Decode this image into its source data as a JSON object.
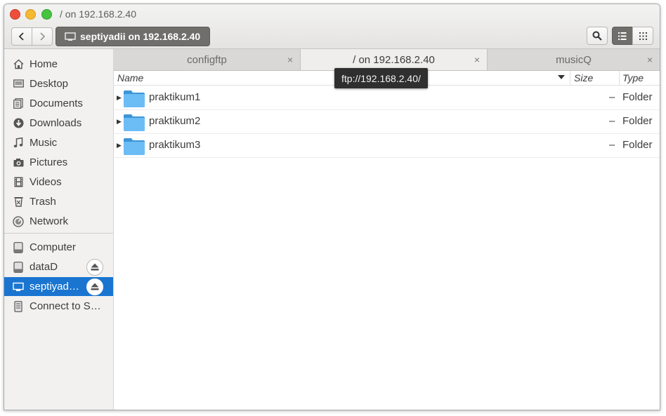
{
  "window": {
    "title": "/ on 192.168.2.40"
  },
  "toolbar": {
    "back_icon": "chevron-left-icon",
    "forward_icon": "chevron-right-icon",
    "location_label": "septiyadii on 192.168.2.40",
    "search_icon": "search-icon",
    "list_view_icon": "list-view-icon",
    "grid_view_icon": "grid-view-icon"
  },
  "sidebar": {
    "places": [
      {
        "label": "Home",
        "icon": "home-icon"
      },
      {
        "label": "Desktop",
        "icon": "desktop-icon"
      },
      {
        "label": "Documents",
        "icon": "documents-icon"
      },
      {
        "label": "Downloads",
        "icon": "downloads-icon"
      },
      {
        "label": "Music",
        "icon": "music-icon"
      },
      {
        "label": "Pictures",
        "icon": "camera-icon"
      },
      {
        "label": "Videos",
        "icon": "film-icon"
      },
      {
        "label": "Trash",
        "icon": "trash-icon"
      },
      {
        "label": "Network",
        "icon": "network-icon"
      }
    ],
    "devices": [
      {
        "label": "Computer",
        "icon": "drive-icon"
      },
      {
        "label": "dataD",
        "icon": "drive-icon",
        "ejectable": true
      },
      {
        "label": "septiyad…",
        "icon": "network-folder-icon",
        "ejectable": true,
        "selected": true
      },
      {
        "label": "Connect to S…",
        "icon": "server-icon"
      }
    ]
  },
  "tabs": [
    {
      "label": "configftp",
      "close": "×"
    },
    {
      "label": "/ on 192.168.2.40",
      "close": "×",
      "active": true
    },
    {
      "label": "musicQ",
      "close": "×"
    }
  ],
  "columns": {
    "name": "Name",
    "size": "Size",
    "type": "Type"
  },
  "files": [
    {
      "name": "praktikum1",
      "size": "–",
      "type": "Folder"
    },
    {
      "name": "praktikum2",
      "size": "–",
      "type": "Folder"
    },
    {
      "name": "praktikum3",
      "size": "–",
      "type": "Folder"
    }
  ],
  "tooltip": "ftp://192.168.2.40/",
  "colors": {
    "selection": "#1a75d1",
    "folder": "#5fb3f2",
    "close": "#ee4f3a",
    "minimize": "#f5b830",
    "maximize": "#45c43f"
  }
}
